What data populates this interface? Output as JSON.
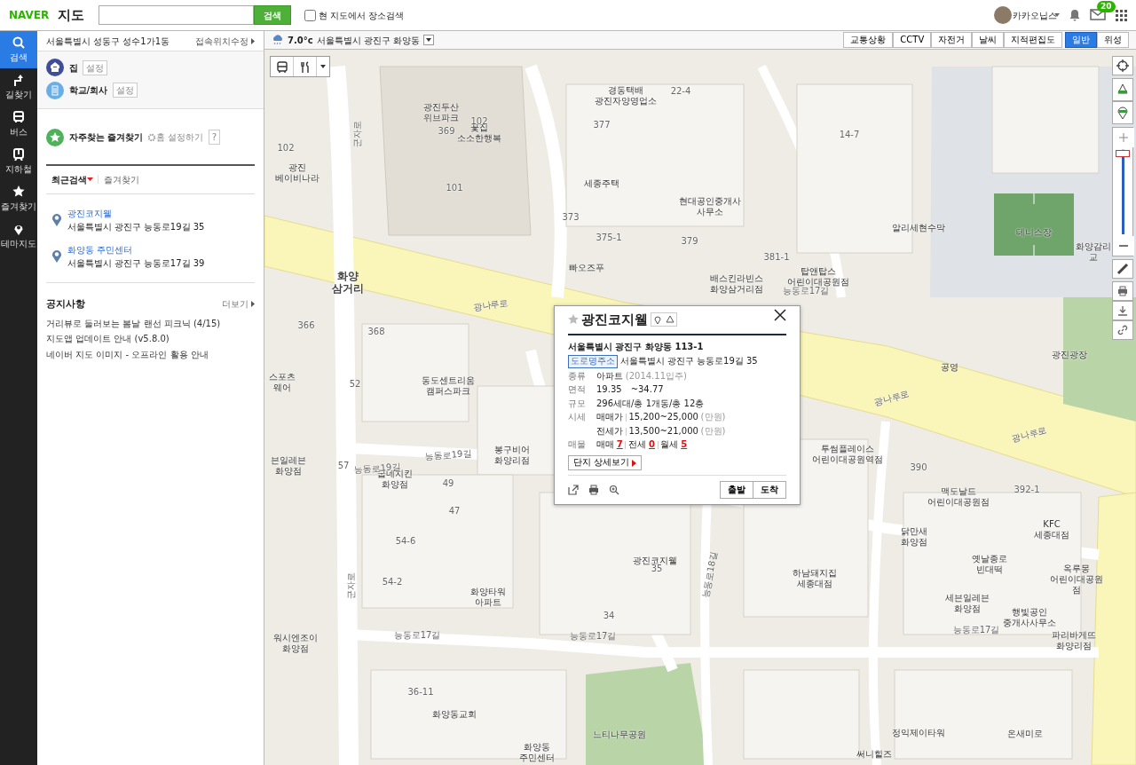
{
  "header": {
    "logo_brand": "NAVER",
    "logo_title": "지도",
    "search_button": "검색",
    "local_search": {
      "label": "현 지도에서 장소검색",
      "checked": false
    },
    "user": {
      "name": "카카오닙스"
    },
    "mail_count": "20"
  },
  "nav": [
    {
      "label": "검색",
      "kind": "search",
      "selected": true
    },
    {
      "label": "길찾기",
      "kind": "route",
      "selected": false
    },
    {
      "label": "버스",
      "kind": "bus",
      "selected": false
    },
    {
      "label": "지하철",
      "kind": "subway",
      "selected": false
    },
    {
      "label": "즐겨찾기",
      "kind": "star",
      "selected": false
    },
    {
      "label": "테마지도",
      "kind": "pin",
      "selected": false
    }
  ],
  "sidebar": {
    "location": "서울특별시 성동구 성수1가1동",
    "location_link": "접속위치수정",
    "places": [
      {
        "label": "집",
        "action": "설정",
        "kind": "home"
      },
      {
        "label": "학교/회사",
        "action": "설정",
        "kind": "office"
      }
    ],
    "favorites": {
      "title": "자주찾는 즐겨찾기",
      "home_setting": "홈 설정하기",
      "help": "?"
    },
    "tabs": [
      {
        "label": "최근검색",
        "selected": true
      },
      {
        "label": "즐겨찾기",
        "selected": false
      }
    ],
    "recent": [
      {
        "name": "광진코지웰",
        "address": "서울특별시 광진구 능동로19길 35"
      },
      {
        "name": "화양동 주민센터",
        "address": "서울특별시 광진구 능동로17길 39"
      }
    ],
    "notices": {
      "title": "공지사항",
      "more": "더보기",
      "items": [
        "거리뷰로 둘러보는 봄날 랜선 피크닉 (4/15)",
        "지도앱 업데이트 안내 (v5.8.0)",
        "네이버 지도 이미지 - 오프라인 활용 안내"
      ]
    }
  },
  "map": {
    "weather": {
      "temp": "7.0°c",
      "location": "서울특별시 광진구 화양동"
    },
    "layer_groups": [
      [
        {
          "label": "교통상황",
          "selected": false
        },
        {
          "label": "CCTV",
          "selected": false
        },
        {
          "label": "자전거",
          "selected": false
        },
        {
          "label": "날씨",
          "selected": false
        },
        {
          "label": "지적편집도",
          "selected": false
        }
      ],
      [
        {
          "label": "일반",
          "selected": true
        },
        {
          "label": "위성",
          "selected": false
        }
      ]
    ],
    "zoom": {
      "level": 0.97
    },
    "labels": [
      {
        "text": "광진두산\n위브파크",
        "kind": "place"
      },
      {
        "text": "꽃집\n소소한행복",
        "kind": "place"
      },
      {
        "text": "경동택배\n광진자양영업소",
        "kind": "place"
      },
      {
        "text": "광진\n베이비나라",
        "kind": "place"
      },
      {
        "text": "세종주택",
        "kind": "place"
      },
      {
        "text": "현대공인중개사\n사무소",
        "kind": "place"
      },
      {
        "text": "빠오즈푸",
        "kind": "place"
      },
      {
        "text": "배스킨라빈스\n화양삼거리점",
        "kind": "place"
      },
      {
        "text": "탑앤탑스\n어린이대공원점",
        "kind": "place"
      },
      {
        "text": "알리세현수막",
        "kind": "place"
      },
      {
        "text": "테니스장",
        "kind": "place"
      },
      {
        "text": "화양감리교",
        "kind": "place"
      },
      {
        "text": "화양\n삼거리",
        "kind": "area"
      },
      {
        "text": "광진광장",
        "kind": "place"
      },
      {
        "text": "공영",
        "kind": "place"
      },
      {
        "text": "스포츠\n웨어",
        "kind": "place"
      },
      {
        "text": "동도센트리움\n캠퍼스파크",
        "kind": "place"
      },
      {
        "text": "봉구비어\n화양리점",
        "kind": "place"
      },
      {
        "text": "투썸플레이스\n어린이대공원역점",
        "kind": "place"
      },
      {
        "text": "맥도날드\n어린이대공원점",
        "kind": "place"
      },
      {
        "text": "굽네치킨\n화양점",
        "kind": "place"
      },
      {
        "text": "븐일레븐\n화양점",
        "kind": "place"
      },
      {
        "text": "광진코지웰",
        "kind": "place"
      },
      {
        "text": "닭만새\n화양점",
        "kind": "place"
      },
      {
        "text": "KFC\n세종대점",
        "kind": "place"
      },
      {
        "text": "옛날종로\n빈대떡",
        "kind": "place"
      },
      {
        "text": "옥루몽\n어린이대공원점",
        "kind": "place"
      },
      {
        "text": "화양타워\n아파트",
        "kind": "place"
      },
      {
        "text": "하남돼지집\n세종대점",
        "kind": "place"
      },
      {
        "text": "세븐일레븐\n화양점",
        "kind": "place"
      },
      {
        "text": "행빛공인\n중개사사무소",
        "kind": "place"
      },
      {
        "text": "워시엔조이\n화양점",
        "kind": "place"
      },
      {
        "text": "파리바게뜨\n화양리점",
        "kind": "place"
      },
      {
        "text": "화양동교회",
        "kind": "place"
      },
      {
        "text": "느티나무공원",
        "kind": "place"
      },
      {
        "text": "정익제이타워",
        "kind": "place"
      },
      {
        "text": "화양동\n주민센터",
        "kind": "place"
      },
      {
        "text": "써니힐즈",
        "kind": "place"
      },
      {
        "text": "온새미로",
        "kind": "place"
      },
      {
        "text": "광나루로",
        "kind": "road"
      },
      {
        "text": "광나루로",
        "kind": "road"
      },
      {
        "text": "광나루로",
        "kind": "road"
      },
      {
        "text": "능동로19길",
        "kind": "road"
      },
      {
        "text": "능동로19길",
        "kind": "road"
      },
      {
        "text": "능동로17길",
        "kind": "road"
      },
      {
        "text": "능동로17길",
        "kind": "road"
      },
      {
        "text": "능동로17길",
        "kind": "road"
      },
      {
        "text": "능동로17길",
        "kind": "road"
      },
      {
        "text": "군자로",
        "kind": "road"
      },
      {
        "text": "군자로",
        "kind": "road"
      },
      {
        "text": "능동로18길",
        "kind": "road"
      },
      {
        "text": "102",
        "kind": "lot"
      },
      {
        "text": "101",
        "kind": "lot"
      },
      {
        "text": "102",
        "kind": "lot"
      },
      {
        "text": "369",
        "kind": "lot"
      },
      {
        "text": "377",
        "kind": "lot"
      },
      {
        "text": "373",
        "kind": "lot"
      },
      {
        "text": "375-1",
        "kind": "lot"
      },
      {
        "text": "379",
        "kind": "lot"
      },
      {
        "text": "366",
        "kind": "lot"
      },
      {
        "text": "368",
        "kind": "lot"
      },
      {
        "text": "52",
        "kind": "lot"
      },
      {
        "text": "57",
        "kind": "lot"
      },
      {
        "text": "49",
        "kind": "lot"
      },
      {
        "text": "47",
        "kind": "lot"
      },
      {
        "text": "54-6",
        "kind": "lot"
      },
      {
        "text": "54-2",
        "kind": "lot"
      },
      {
        "text": "35",
        "kind": "lot"
      },
      {
        "text": "34",
        "kind": "lot"
      },
      {
        "text": "36-11",
        "kind": "lot"
      },
      {
        "text": "390",
        "kind": "lot"
      },
      {
        "text": "392-1",
        "kind": "lot"
      },
      {
        "text": "381-1",
        "kind": "lot"
      },
      {
        "text": "14-7",
        "kind": "lot"
      },
      {
        "text": "22-4",
        "kind": "lot"
      }
    ],
    "popup": {
      "title": "광진코지웰",
      "address": "서울특별시 광진구 화양동 113-1",
      "road_tag": "도로명주소",
      "road_address": "서울특별시 광진구 능동로19길 35",
      "rows": [
        {
          "label": "종류",
          "value": "아파트",
          "note": "(2014.11입주)"
        },
        {
          "label": "면적",
          "value": "19.35　~34.77"
        },
        {
          "label": "규모",
          "value": "296세대/총 1개동/총 12층"
        },
        {
          "label": "시세",
          "sub": "매매가",
          "value": "15,200~25,000",
          "note": "(만원)"
        },
        {
          "sub": "전세가",
          "value": "13,500~21,000",
          "note": "(만원)"
        }
      ],
      "listing_label": "매물",
      "listings": [
        {
          "label": "매매",
          "count": "7"
        },
        {
          "label": "전세",
          "count": "0"
        },
        {
          "label": "월세",
          "count": "5"
        }
      ],
      "detail_button": "단지 상세보기",
      "route_buttons": [
        "출발",
        "도착"
      ]
    }
  }
}
